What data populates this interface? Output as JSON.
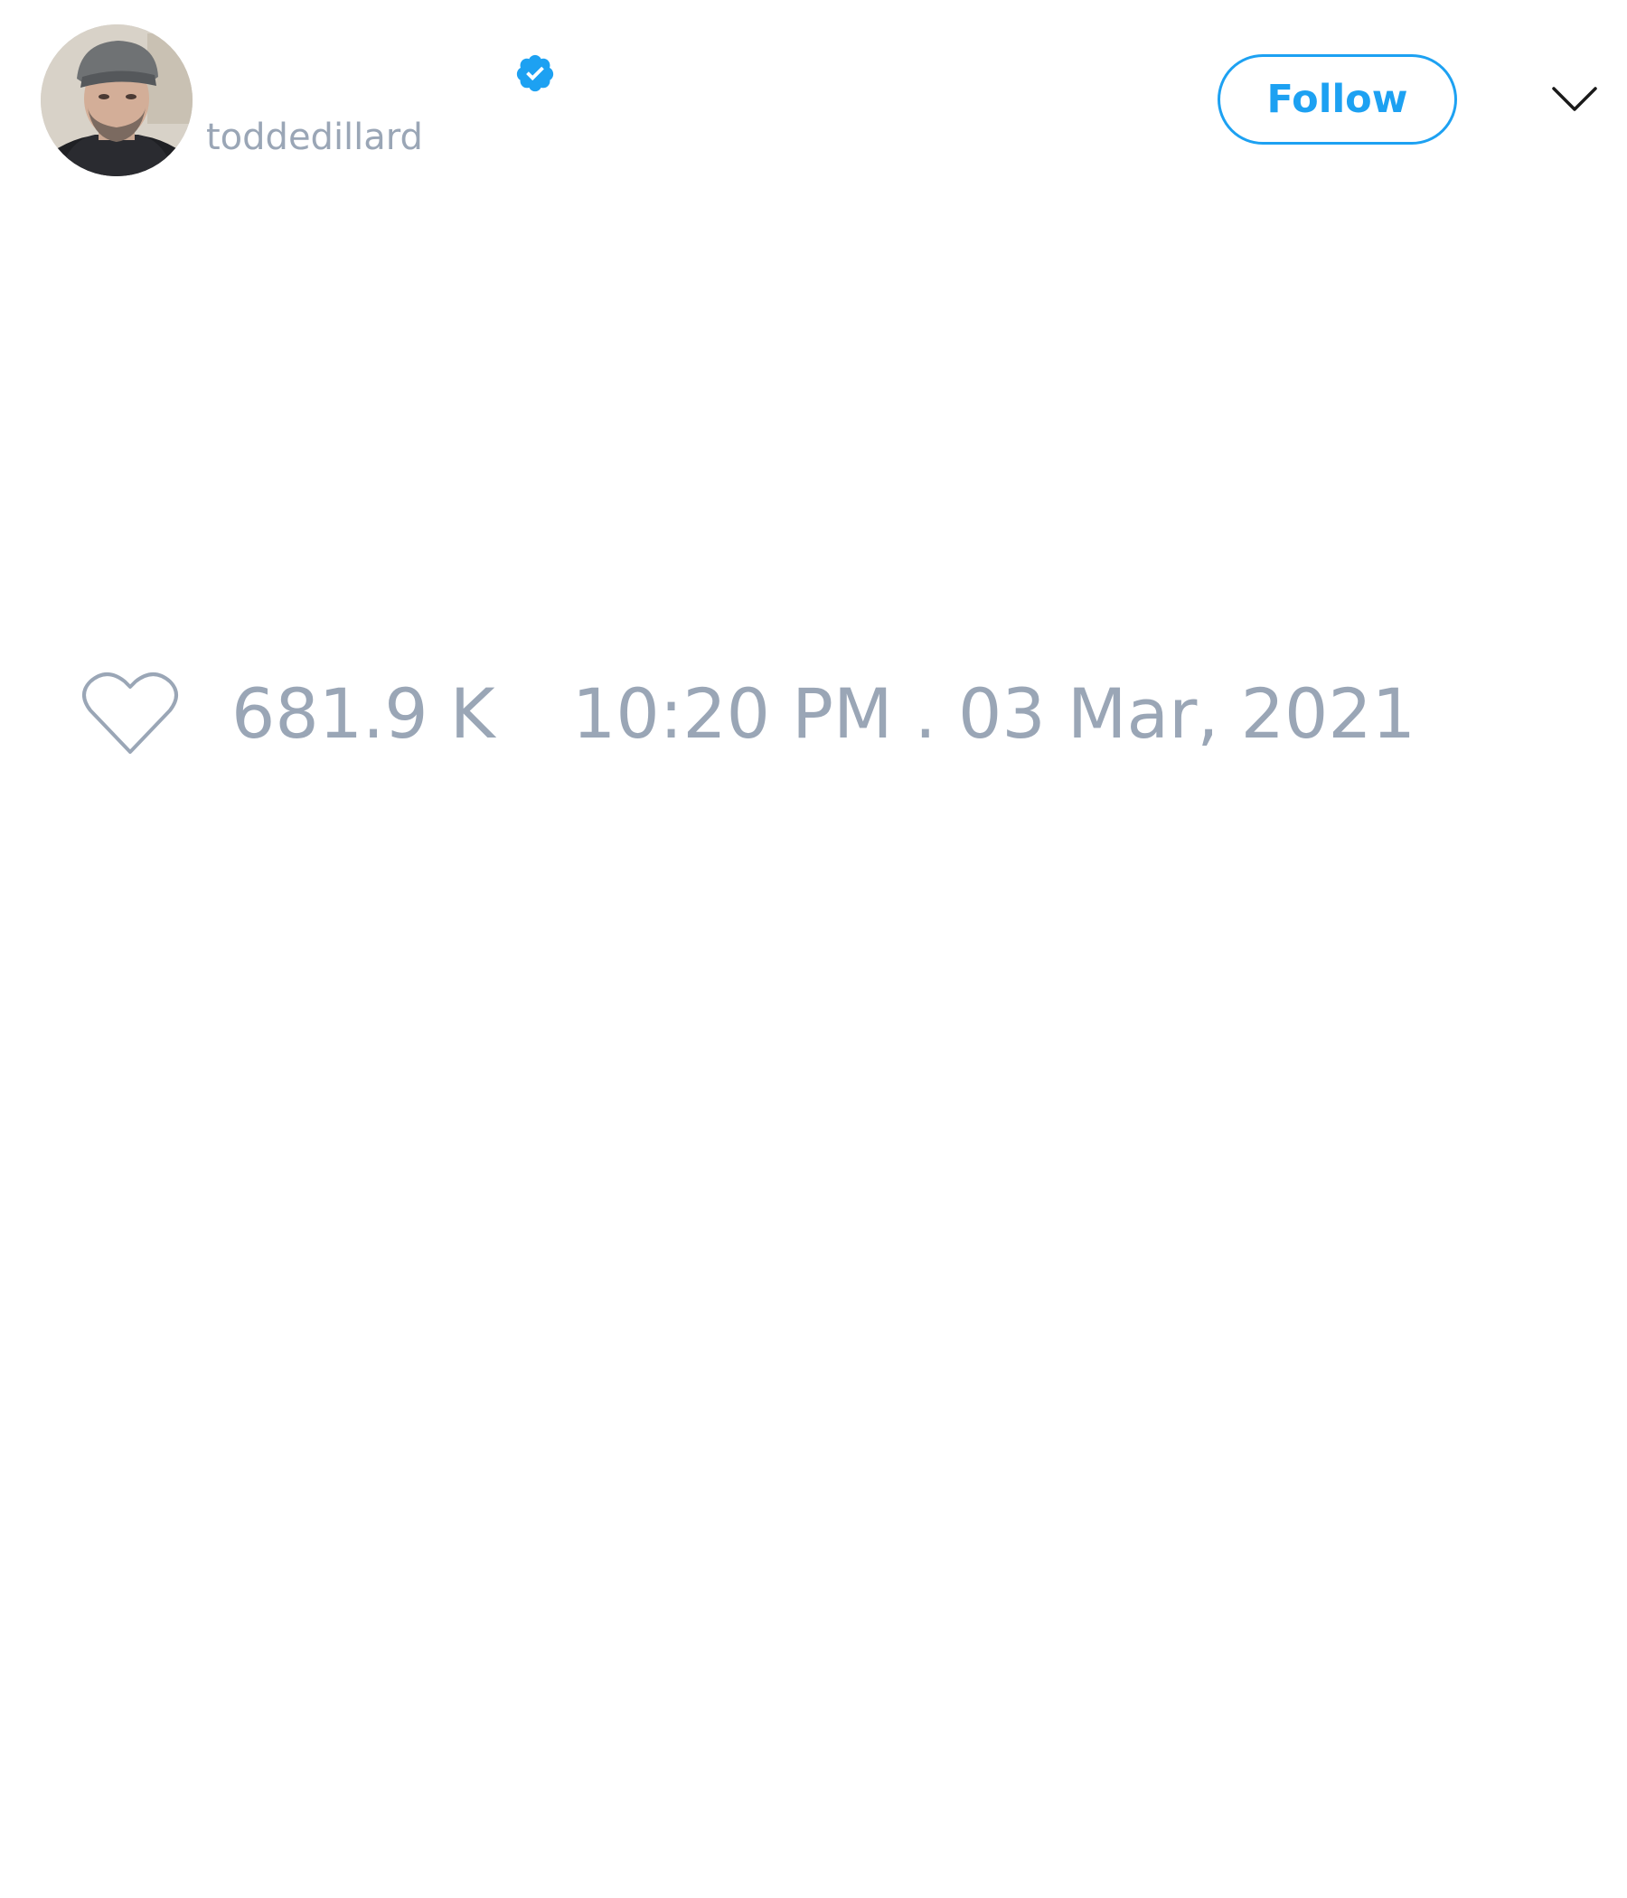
{
  "tweet": {
    "author": {
      "username": "toddedillard",
      "avatar_icon": "profile-photo",
      "verified_icon": "verified-badge-icon"
    },
    "follow_label": "Follow",
    "menu_icon": "chevron-down-icon",
    "likes": {
      "icon": "heart-outline-icon",
      "count": "681.9 K"
    },
    "timestamp": "10:20 PM . 03 Mar, 2021"
  },
  "colors": {
    "accent": "#1da1f2",
    "muted_text": "#9aa6b6",
    "background": "#ffffff"
  }
}
